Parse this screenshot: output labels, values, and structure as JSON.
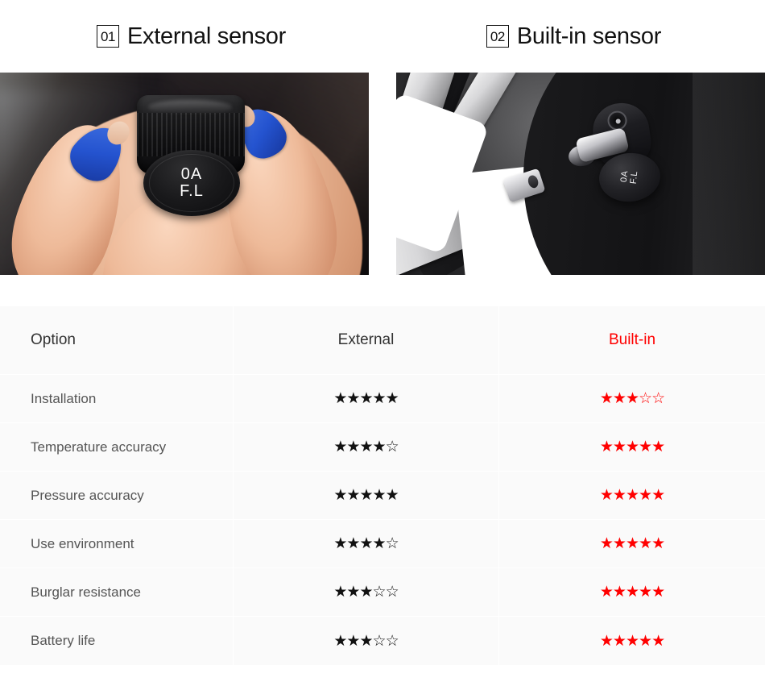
{
  "headers": [
    {
      "number": "01",
      "title": "External sensor"
    },
    {
      "number": "02",
      "title": "Built-in sensor"
    }
  ],
  "photos": [
    {
      "name": "external-sensor-photo",
      "caption_on_device_line1": "0A",
      "caption_on_device_line2": "F.L"
    },
    {
      "name": "built-in-sensor-photo",
      "caption_on_device_line1": "0A",
      "caption_on_device_line2": "F.L"
    }
  ],
  "table": {
    "columns": [
      "Option",
      "External",
      "Built-in"
    ],
    "column_colors": {
      "option": "#333333",
      "external": "#333333",
      "built_in": "#ff0000"
    },
    "star_colors": {
      "external": "#111111",
      "built_in": "#ff0000"
    },
    "max_stars": 5,
    "rows": [
      {
        "option": "Installation",
        "external": 5,
        "built_in": 3
      },
      {
        "option": "Temperature accuracy",
        "external": 4,
        "built_in": 5
      },
      {
        "option": "Pressure accuracy",
        "external": 5,
        "built_in": 5
      },
      {
        "option": "Use environment",
        "external": 4,
        "built_in": 5
      },
      {
        "option": "Burglar resistance",
        "external": 3,
        "built_in": 5
      },
      {
        "option": "Battery life",
        "external": 3,
        "built_in": 5
      }
    ]
  }
}
